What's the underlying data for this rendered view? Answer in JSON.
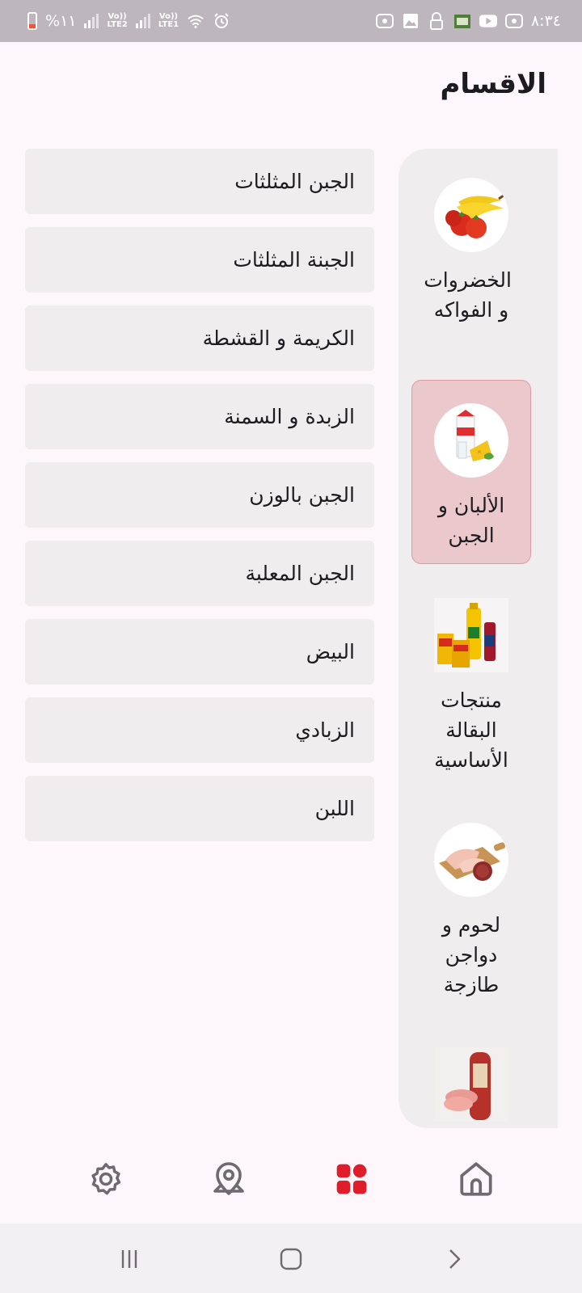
{
  "status_bar": {
    "battery_percent": "%١١",
    "sim2_label_top": "Vo))",
    "sim2_label_bottom": "LTE2",
    "sim1_label_top": "Vo))",
    "sim1_label_bottom": "LTE1",
    "time": "٨:٣٤",
    "icons": [
      "battery-icon",
      "signal-icon",
      "wifi-icon",
      "alarm-icon",
      "screen-record-icon",
      "gallery-icon",
      "lock-icon",
      "app-icon",
      "youtube-icon",
      "screen-record-icon"
    ]
  },
  "page": {
    "title": "الاقسام"
  },
  "categories": [
    {
      "label": "الخضروات و الفواكه",
      "icon": "fruits-vegetables-image",
      "selected": false
    },
    {
      "label": "الألبان و الجبن",
      "icon": "dairy-cheese-image",
      "selected": true
    },
    {
      "label": "منتجات البقالة الأساسية",
      "icon": "grocery-staples-image",
      "selected": false
    },
    {
      "label": "لحوم و دواجن طازجة",
      "icon": "fresh-meat-poultry-image",
      "selected": false
    },
    {
      "label": "",
      "icon": "cold-cuts-image",
      "selected": false
    }
  ],
  "subcategories": [
    "الجبن المثلثات",
    "الجبنة المثلثات",
    "الكريمة و القشطة",
    "الزبدة و السمنة",
    "الجبن بالوزن",
    "الجبن المعلبة",
    "البيض",
    "الزبادي",
    "اللبن"
  ],
  "bottom_nav": {
    "items": [
      {
        "icon": "settings-gear-icon",
        "active": false
      },
      {
        "icon": "location-pin-icon",
        "active": false
      },
      {
        "icon": "categories-grid-icon",
        "active": true
      },
      {
        "icon": "home-icon",
        "active": false
      }
    ],
    "active_color": "#e01e2b",
    "inactive_color": "#6f6a70"
  },
  "system_nav": {
    "icons": [
      "recent-apps-icon",
      "home-square-icon",
      "back-icon"
    ]
  }
}
